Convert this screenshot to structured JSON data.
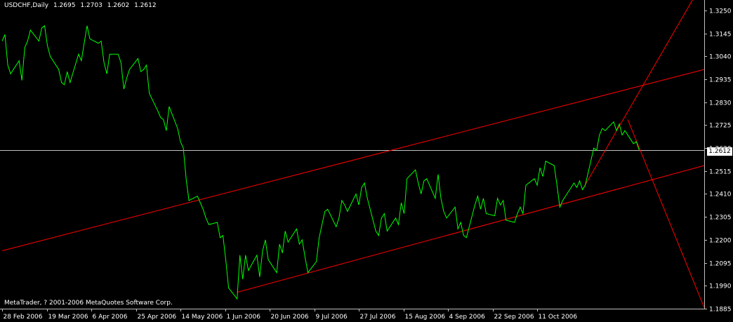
{
  "header": {
    "symbol_timeframe": "USDCHF,Daily",
    "open": "1.2695",
    "high": "1.2703",
    "low": "1.2602",
    "close": "1.2612"
  },
  "copyright": "MetaTrader, ? 2001-2006 MetaQuotes Software Corp.",
  "current_price_label": "1.2612",
  "colors": {
    "background": "#000000",
    "price_line": "#00ff00",
    "channel_lines": "#ff0000",
    "current_price_line": "#c0c0c0",
    "axis": "#c0c0c0",
    "text": "#ffffff"
  },
  "chart_data": {
    "type": "line",
    "title": "USDCHF,Daily",
    "xlabel": "",
    "ylabel": "",
    "ylim": [
      1.1885,
      1.3285
    ],
    "xlim": [
      "2006-02-28",
      "2006-11-03"
    ],
    "x_ticks": [
      "28 Feb 2006",
      "19 Mar 2006",
      "6 Apr 2006",
      "25 Apr 2006",
      "14 May 2006",
      "1 Jun 2006",
      "20 Jun 2006",
      "9 Jul 2006",
      "27 Jul 2006",
      "15 Aug 2006",
      "4 Sep 2006",
      "22 Sep 2006",
      "11 Oct 2006"
    ],
    "y_ticks": [
      "1.3250",
      "1.3145",
      "1.3040",
      "1.2935",
      "1.2830",
      "1.2725",
      "1.2620",
      "1.2515",
      "1.2410",
      "1.2305",
      "1.2200",
      "1.2095",
      "1.1990",
      "1.1885"
    ],
    "current_price": 1.2612,
    "series": [
      {
        "values": [
          [
            "2006-02-28",
            1.311
          ],
          [
            "2006-03-01",
            1.314
          ],
          [
            "2006-03-02",
            1.3
          ],
          [
            "2006-03-03",
            1.296
          ],
          [
            "2006-03-06",
            1.302
          ],
          [
            "2006-03-07",
            1.293
          ],
          [
            "2006-03-08",
            1.308
          ],
          [
            "2006-03-09",
            1.311
          ],
          [
            "2006-03-10",
            1.316
          ],
          [
            "2006-03-13",
            1.311
          ],
          [
            "2006-03-14",
            1.317
          ],
          [
            "2006-03-15",
            1.318
          ],
          [
            "2006-03-16",
            1.309
          ],
          [
            "2006-03-17",
            1.304
          ],
          [
            "2006-03-20",
            1.298
          ],
          [
            "2006-03-21",
            1.292
          ],
          [
            "2006-03-22",
            1.291
          ],
          [
            "2006-03-23",
            1.297
          ],
          [
            "2006-03-24",
            1.292
          ],
          [
            "2006-03-27",
            1.305
          ],
          [
            "2006-03-28",
            1.302
          ],
          [
            "2006-03-29",
            1.31
          ],
          [
            "2006-03-30",
            1.318
          ],
          [
            "2006-03-31",
            1.312
          ],
          [
            "2006-04-03",
            1.31
          ],
          [
            "2006-04-04",
            1.311
          ],
          [
            "2006-04-05",
            1.301
          ],
          [
            "2006-04-06",
            1.296
          ],
          [
            "2006-04-07",
            1.305
          ],
          [
            "2006-04-10",
            1.305
          ],
          [
            "2006-04-11",
            1.301
          ],
          [
            "2006-04-12",
            1.289
          ],
          [
            "2006-04-13",
            1.294
          ],
          [
            "2006-04-14",
            1.298
          ],
          [
            "2006-04-17",
            1.303
          ],
          [
            "2006-04-18",
            1.297
          ],
          [
            "2006-04-19",
            1.298
          ],
          [
            "2006-04-20",
            1.3
          ],
          [
            "2006-04-21",
            1.287
          ],
          [
            "2006-04-24",
            1.279
          ],
          [
            "2006-04-25",
            1.276
          ],
          [
            "2006-04-26",
            1.275
          ],
          [
            "2006-04-27",
            1.27
          ],
          [
            "2006-04-28",
            1.281
          ],
          [
            "2006-05-01",
            1.271
          ],
          [
            "2006-05-02",
            1.265
          ],
          [
            "2006-05-03",
            1.262
          ],
          [
            "2006-05-04",
            1.248
          ],
          [
            "2006-05-05",
            1.238
          ],
          [
            "2006-05-08",
            1.24
          ],
          [
            "2006-05-09",
            1.237
          ],
          [
            "2006-05-10",
            1.234
          ],
          [
            "2006-05-11",
            1.23
          ],
          [
            "2006-05-12",
            1.227
          ],
          [
            "2006-05-15",
            1.228
          ],
          [
            "2006-05-16",
            1.221
          ],
          [
            "2006-05-17",
            1.222
          ],
          [
            "2006-05-18",
            1.211
          ],
          [
            "2006-05-19",
            1.198
          ],
          [
            "2006-05-22",
            1.193
          ],
          [
            "2006-05-23",
            1.213
          ],
          [
            "2006-05-24",
            1.202
          ],
          [
            "2006-05-25",
            1.213
          ],
          [
            "2006-05-26",
            1.206
          ],
          [
            "2006-05-29",
            1.213
          ],
          [
            "2006-05-30",
            1.203
          ],
          [
            "2006-05-31",
            1.215
          ],
          [
            "2006-06-01",
            1.22
          ],
          [
            "2006-06-02",
            1.211
          ],
          [
            "2006-06-05",
            1.205
          ],
          [
            "2006-06-06",
            1.218
          ],
          [
            "2006-06-07",
            1.214
          ],
          [
            "2006-06-08",
            1.224
          ],
          [
            "2006-06-09",
            1.219
          ],
          [
            "2006-06-12",
            1.225
          ],
          [
            "2006-06-13",
            1.218
          ],
          [
            "2006-06-14",
            1.22
          ],
          [
            "2006-06-15",
            1.212
          ],
          [
            "2006-06-16",
            1.205
          ],
          [
            "2006-06-19",
            1.21
          ],
          [
            "2006-06-20",
            1.221
          ],
          [
            "2006-06-21",
            1.227
          ],
          [
            "2006-06-22",
            1.233
          ],
          [
            "2006-06-23",
            1.234
          ],
          [
            "2006-06-26",
            1.226
          ],
          [
            "2006-06-27",
            1.23
          ],
          [
            "2006-06-28",
            1.238
          ],
          [
            "2006-06-29",
            1.236
          ],
          [
            "2006-06-30",
            1.233
          ],
          [
            "2006-07-03",
            1.241
          ],
          [
            "2006-07-04",
            1.236
          ],
          [
            "2006-07-05",
            1.244
          ],
          [
            "2006-07-06",
            1.246
          ],
          [
            "2006-07-07",
            1.239
          ],
          [
            "2006-07-10",
            1.224
          ],
          [
            "2006-07-11",
            1.222
          ],
          [
            "2006-07-12",
            1.23
          ],
          [
            "2006-07-13",
            1.232
          ],
          [
            "2006-07-14",
            1.224
          ],
          [
            "2006-07-17",
            1.23
          ],
          [
            "2006-07-18",
            1.227
          ],
          [
            "2006-07-19",
            1.237
          ],
          [
            "2006-07-20",
            1.232
          ],
          [
            "2006-07-21",
            1.248
          ],
          [
            "2006-07-24",
            1.252
          ],
          [
            "2006-07-25",
            1.246
          ],
          [
            "2006-07-26",
            1.241
          ],
          [
            "2006-07-27",
            1.247
          ],
          [
            "2006-07-28",
            1.248
          ],
          [
            "2006-07-31",
            1.239
          ],
          [
            "2006-08-01",
            1.25
          ],
          [
            "2006-08-02",
            1.239
          ],
          [
            "2006-08-03",
            1.233
          ],
          [
            "2006-08-04",
            1.23
          ],
          [
            "2006-08-07",
            1.235
          ],
          [
            "2006-08-08",
            1.225
          ],
          [
            "2006-08-09",
            1.228
          ],
          [
            "2006-08-10",
            1.222
          ],
          [
            "2006-08-11",
            1.221
          ],
          [
            "2006-08-14",
            1.236
          ],
          [
            "2006-08-15",
            1.24
          ],
          [
            "2006-08-16",
            1.234
          ],
          [
            "2006-08-17",
            1.239
          ],
          [
            "2006-08-18",
            1.232
          ],
          [
            "2006-08-21",
            1.231
          ],
          [
            "2006-08-22",
            1.239
          ],
          [
            "2006-08-23",
            1.236
          ],
          [
            "2006-08-24",
            1.238
          ],
          [
            "2006-08-25",
            1.229
          ],
          [
            "2006-08-28",
            1.228
          ],
          [
            "2006-08-29",
            1.232
          ],
          [
            "2006-08-30",
            1.235
          ],
          [
            "2006-08-31",
            1.232
          ],
          [
            "2006-09-01",
            1.245
          ],
          [
            "2006-09-04",
            1.248
          ],
          [
            "2006-09-05",
            1.245
          ],
          [
            "2006-09-06",
            1.253
          ],
          [
            "2006-09-07",
            1.249
          ],
          [
            "2006-09-08",
            1.256
          ],
          [
            "2006-09-11",
            1.254
          ],
          [
            "2006-09-12",
            1.245
          ],
          [
            "2006-09-13",
            1.235
          ],
          [
            "2006-09-14",
            1.238
          ],
          [
            "2006-09-15",
            1.24
          ],
          [
            "2006-09-18",
            1.246
          ],
          [
            "2006-09-19",
            1.244
          ],
          [
            "2006-09-20",
            1.247
          ],
          [
            "2006-09-21",
            1.243
          ],
          [
            "2006-09-22",
            1.245
          ],
          [
            "2006-09-25",
            1.262
          ],
          [
            "2006-09-26",
            1.261
          ],
          [
            "2006-09-27",
            1.268
          ],
          [
            "2006-09-28",
            1.271
          ],
          [
            "2006-09-29",
            1.27
          ],
          [
            "2006-10-02",
            1.274
          ],
          [
            "2006-10-03",
            1.27
          ],
          [
            "2006-10-04",
            1.273
          ],
          [
            "2006-10-05",
            1.268
          ],
          [
            "2006-10-06",
            1.27
          ],
          [
            "2006-10-09",
            1.264
          ],
          [
            "2006-10-10",
            1.265
          ],
          [
            "2006-10-11",
            1.2612
          ]
        ]
      }
    ],
    "annotations": {
      "channel_upper": [
        [
          "2006-02-28",
          1.215
        ],
        [
          "2006-11-03",
          1.298
        ]
      ],
      "channel_lower": [
        [
          "2006-05-22",
          1.196
        ],
        [
          "2006-11-03",
          1.254
        ]
      ],
      "steep_line": [
        [
          "2006-09-21",
          1.243
        ],
        [
          "2006-11-03",
          1.339
        ]
      ],
      "down_line": [
        [
          "2006-10-07",
          1.275
        ],
        [
          "2006-11-03",
          1.189
        ]
      ]
    },
    "grid": false,
    "legend": "none"
  }
}
